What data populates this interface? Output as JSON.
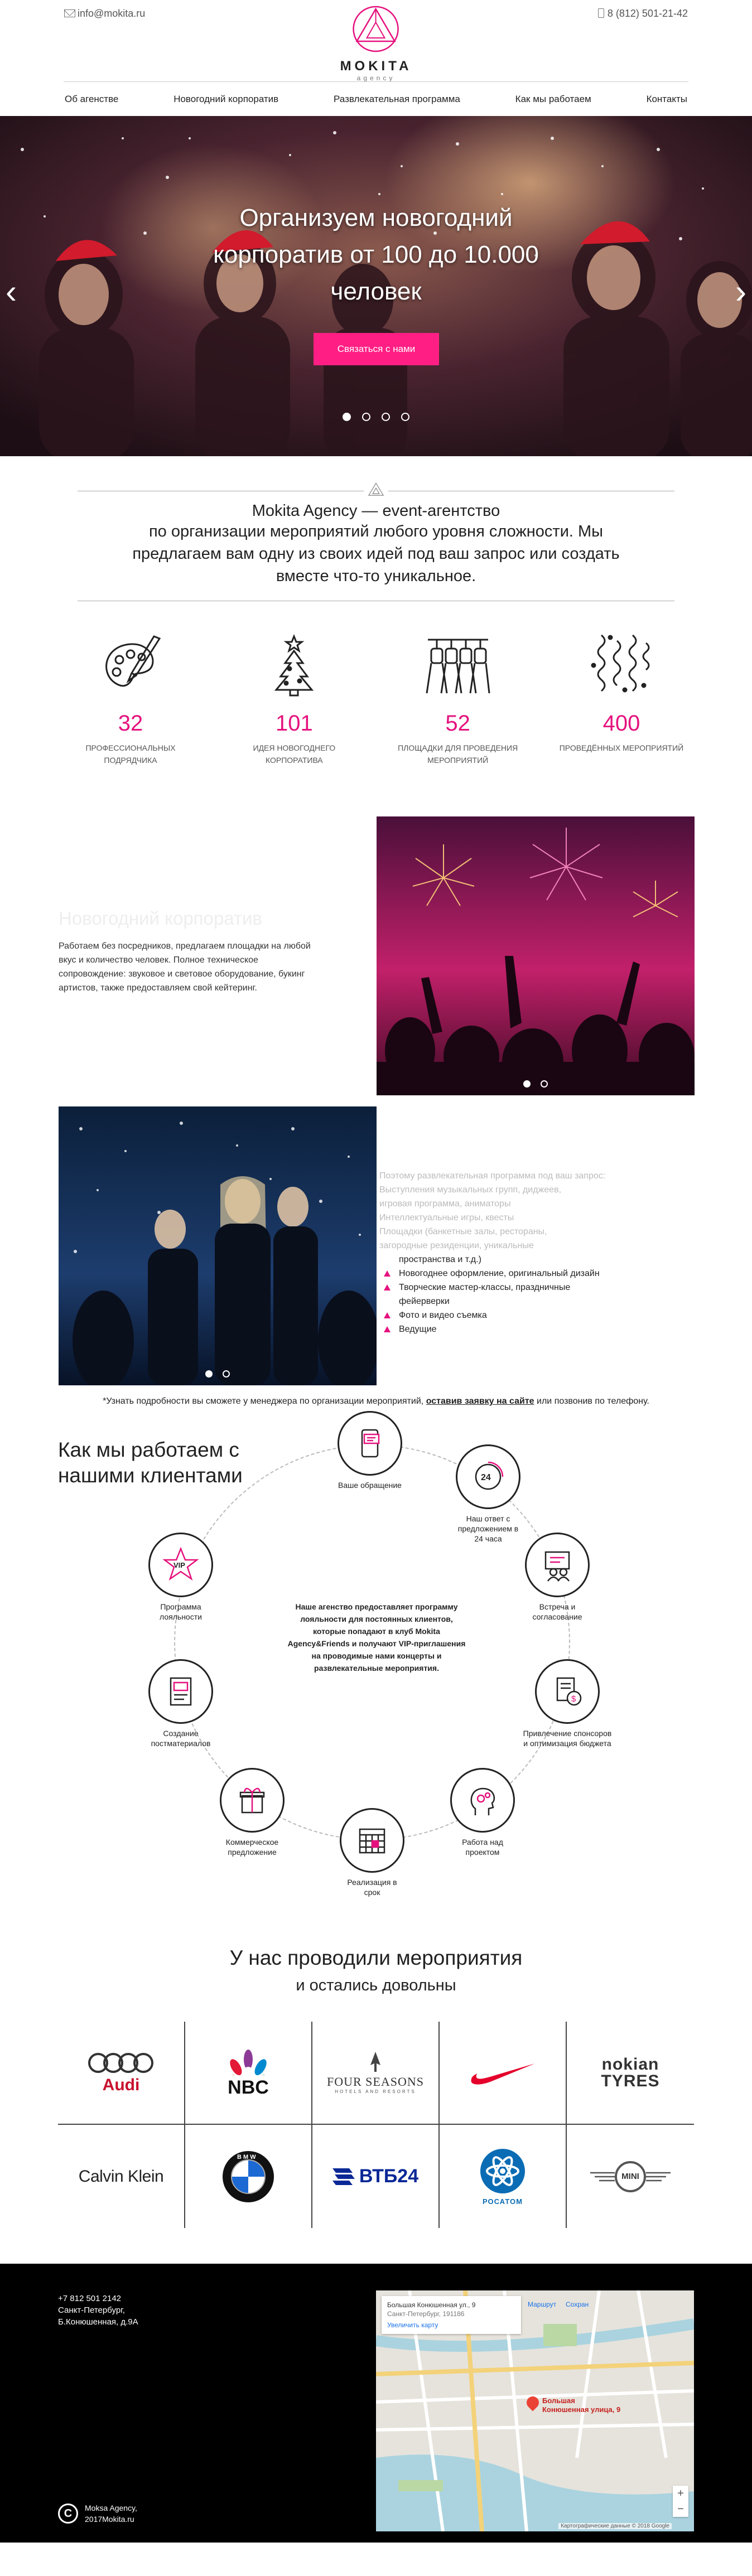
{
  "header": {
    "email": "info@mokita.ru",
    "phone": "8 (812) 501-21-42",
    "brand": "MOKITA",
    "brand_sub": "agency",
    "nav": [
      "Об агенстве",
      "Новогодний корпоратив",
      "Развлекательная программа",
      "Как мы работаем",
      "Контакты"
    ]
  },
  "hero": {
    "title": "Организуем новогодний корпоратив от 100 до 10.000 человек",
    "cta": "Связаться с нами",
    "prev": "‹",
    "next": "›"
  },
  "about": {
    "title": "Mokita Agency — event-агентство",
    "text": "по организации мероприятий любого уровня сложности. Мы предлагаем вам одну из своих идей под ваш запрос или создать вместе что-то уникальное."
  },
  "stats": [
    {
      "num": "32",
      "label": "профессиональных подрядчика",
      "icon": "palette-icon"
    },
    {
      "num": "101",
      "label": "идея новогоднего корпоратива",
      "icon": "christmas-tree-icon"
    },
    {
      "num": "52",
      "label": "площадки для проведения мероприятий",
      "icon": "stage-lights-icon"
    },
    {
      "num": "400",
      "label": "проведённых мероприятий",
      "icon": "serpentine-icon"
    }
  ],
  "feature1": {
    "title": "Новогодний корпоратив",
    "text": "Работаем без посредников, предлагаем площадки на любой вкус и количество человек. Полное техническое сопровождение: звуковое и световое оборудование, букинг артистов, также предоставляем свой кейтеринг."
  },
  "feature2": {
    "faint_intro": "Поэтому развлекательная программа под ваш запрос:",
    "items": [
      {
        "text": "Выступления музыкальных групп, диджеев,",
        "faint": true
      },
      {
        "text": "игровая программа, аниматоры",
        "faint": true
      },
      {
        "text": "Интеллектуальные игры, квесты",
        "faint": true
      },
      {
        "text": "Площадки (банкетные залы, рестораны,",
        "faint": true
      },
      {
        "text": "загородные резиденции, уникальные",
        "faint": true
      },
      {
        "text": "пространства и т.д.)",
        "faint": false
      },
      {
        "text": "Новогоднее оформление, оригинальный дизайн",
        "faint": false,
        "bullet": true
      },
      {
        "text": "Творческие мастер-классы, праздничные фейерверки",
        "faint": false,
        "bullet": true
      },
      {
        "text": "Фото и видео съемка",
        "faint": false,
        "bullet": true
      },
      {
        "text": "Ведущие",
        "faint": false,
        "bullet": true
      }
    ]
  },
  "note": {
    "before": "*Узнать подробности вы сможете у менеджера по организации мероприятий,",
    "link": "оставив заявку на сайте",
    "after": "или позвонив по телефону."
  },
  "process": {
    "title": "Как мы работаем с нашими клиентами",
    "center": "Наше агенство предоставляет программу лояльности для постоянных клиентов, которые попадают в клуб Mokita Agency&Friends и получают VIP-приглашения на проводимые нами концерты и развлекательные мероприятия.",
    "steps": [
      {
        "label": "Ваше обращение",
        "icon": "phone-message-icon"
      },
      {
        "label": "Наш ответ с предложением в 24 часа",
        "icon": "24-hours-icon"
      },
      {
        "label": "Встреча и согласование",
        "icon": "meeting-icon"
      },
      {
        "label": "Привлечение спонсоров и оптимизация бюджета",
        "icon": "budget-icon"
      },
      {
        "label": "Работа над проектом",
        "icon": "head-gears-icon"
      },
      {
        "label": "Реализация в срок",
        "icon": "calendar-icon"
      },
      {
        "label": "Коммерческое предложение",
        "icon": "gift-offer-icon"
      },
      {
        "label": "Создание постматериалов",
        "icon": "report-icon"
      },
      {
        "label": "Программа лояльности",
        "icon": "vip-star-icon"
      }
    ]
  },
  "clients": {
    "title": "У нас проводили мероприятия",
    "subtitle": "и остались довольны",
    "logos": [
      "Audi",
      "NBC",
      "FOUR SEASONS",
      "Nike",
      "nokian TYRES",
      "Calvin Klein",
      "BMW",
      "ВТБ24",
      "РОСАТОМ",
      "MINI"
    ],
    "four_seasons_sub": "HOTELS AND RESORTS"
  },
  "footer": {
    "phone": "+7 812 501 2142",
    "city": "Санкт-Петербург,",
    "address": "Б.Конюшенная, д.9А",
    "copy1": "Moksa Agency,",
    "copy2": "2017Mokita.ru",
    "map": {
      "address_line1": "Большая Конюшенная ул., 9",
      "address_line2": "Санкт-Петербург, 191186",
      "bigger": "Увеличить карту",
      "pin_label1": "Большая",
      "pin_label2": "Конюшенная улица, 9",
      "terms": "Картографические данные © 2018 Google",
      "marker": "Маршрут",
      "save": "Сохран"
    }
  },
  "colors": {
    "accent": "#e5127e",
    "cta": "#ff1f84",
    "footer": "#000000"
  }
}
